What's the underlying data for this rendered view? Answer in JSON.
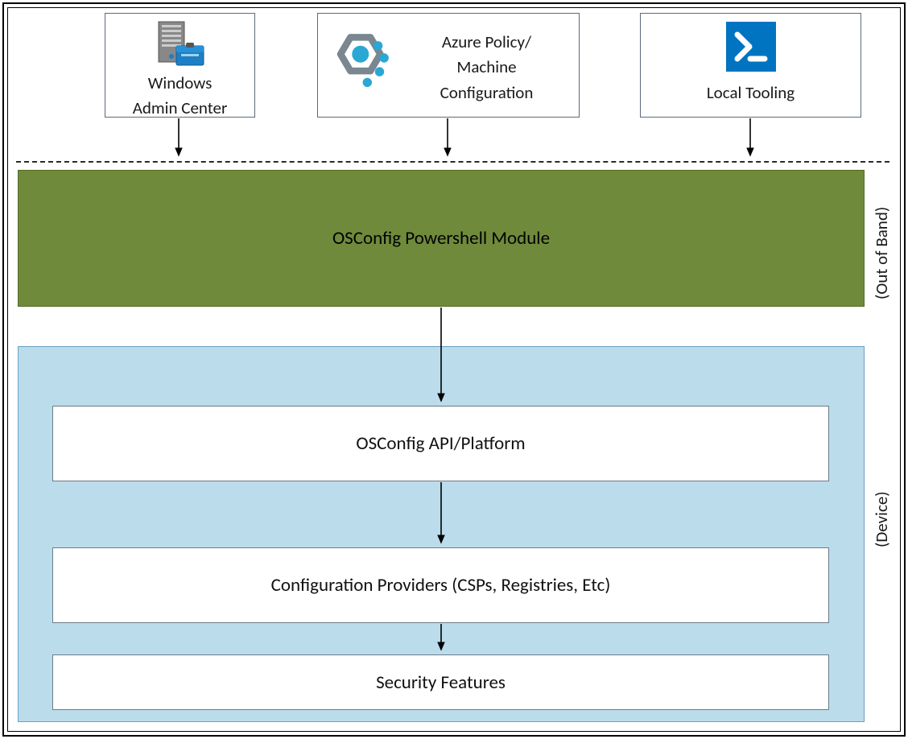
{
  "top_row": {
    "wac": {
      "line1": "Windows",
      "line2": "Admin Center"
    },
    "azure_policy": {
      "line1": "Azure Policy/",
      "line2": "Machine",
      "line3": "Configuration"
    },
    "local_tooling": {
      "label": "Local Tooling"
    }
  },
  "osconfig_module": {
    "label": "OSConfig Powershell Module"
  },
  "device_blocks": {
    "api": "OSConfig API/Platform",
    "providers": "Configuration Providers (CSPs, Registries, Etc)",
    "features": "Security Features"
  },
  "side_labels": {
    "out_of_band": "(Out of Band)",
    "device": "(Device)"
  },
  "colors": {
    "osconfig_green": "#6f8a3b",
    "device_blue": "#bbdceb",
    "powershell_blue": "#0174c1"
  }
}
